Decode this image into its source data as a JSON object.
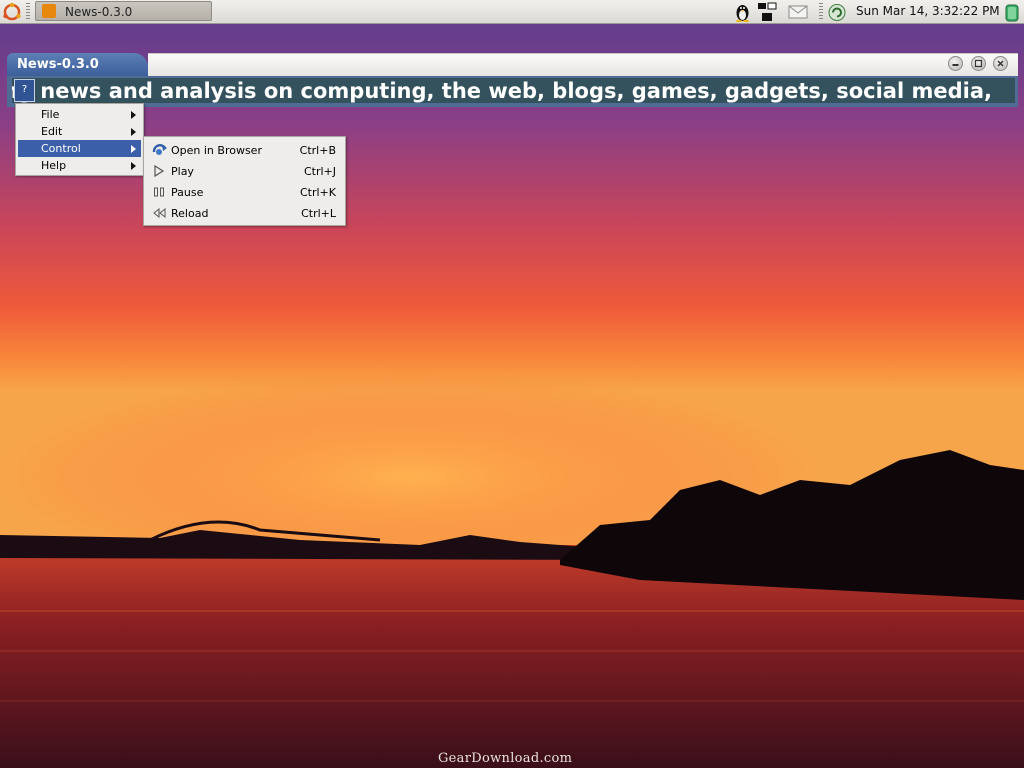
{
  "panel": {
    "taskbar_window_title": "News-0.3.0",
    "clock": "Sun Mar 14,  3:32:22 PM"
  },
  "window": {
    "title": "News-0.3.0",
    "ticker_text": "ng news and analysis on computing, the web, blogs, games, gadgets, social media,",
    "help_button_label": "?"
  },
  "menu": {
    "items": [
      {
        "label": "File",
        "has_submenu": true
      },
      {
        "label": "Edit",
        "has_submenu": true
      },
      {
        "label": "Control",
        "has_submenu": true,
        "active": true
      },
      {
        "label": "Help",
        "has_submenu": true
      }
    ]
  },
  "control_submenu": {
    "items": [
      {
        "label": "Open in Browser",
        "shortcut": "Ctrl+B",
        "icon": "browser-refresh-icon"
      },
      {
        "label": "Play",
        "shortcut": "Ctrl+J",
        "icon": "play-icon"
      },
      {
        "label": "Pause",
        "shortcut": "Ctrl+K",
        "icon": "pause-icon"
      },
      {
        "label": "Reload",
        "shortcut": "Ctrl+L",
        "icon": "rewind-icon"
      }
    ]
  },
  "watermark": "GearDownload.com",
  "colors": {
    "menu_highlight": "#3b5fa8",
    "window_tab": "#3d5f9a",
    "ticker_background": "#33525d"
  }
}
